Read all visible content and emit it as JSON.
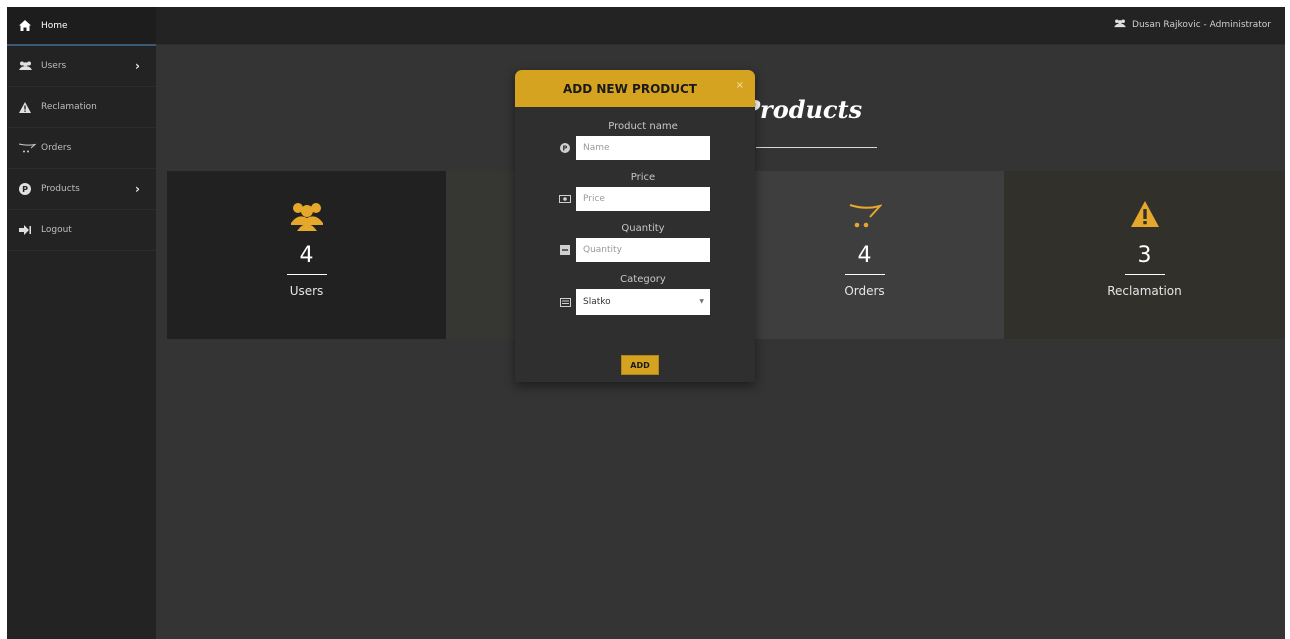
{
  "sidebar": {
    "items": [
      {
        "label": "Home",
        "icon": "home-icon"
      },
      {
        "label": "Users",
        "icon": "users-icon"
      },
      {
        "label": "Reclamation",
        "icon": "warning-icon"
      },
      {
        "label": "Orders",
        "icon": "cart-icon"
      },
      {
        "label": "Products",
        "icon": "product-icon"
      },
      {
        "label": "Logout",
        "icon": "logout-icon"
      }
    ]
  },
  "topbar": {
    "user": "Dusan Rajkovic - Administrator"
  },
  "page": {
    "title": "Products"
  },
  "cards": [
    {
      "value": "4",
      "label": "Users",
      "icon": "users-icon"
    },
    {
      "value": "4",
      "label": "Orders",
      "icon": "cart-icon"
    },
    {
      "value": "3",
      "label": "Reclamation",
      "icon": "warning-icon"
    }
  ],
  "modal": {
    "title": "ADD NEW PRODUCT",
    "close": "×",
    "fields": [
      {
        "label": "Product name",
        "placeholder": "Name"
      },
      {
        "label": "Price",
        "placeholder": "Price"
      },
      {
        "label": "Quantity",
        "placeholder": "Quantity"
      },
      {
        "label": "Category",
        "value": "Slatko"
      }
    ],
    "submit_label": "ADD"
  },
  "colors": {
    "accent": "#d6a321",
    "sidebar": "#232323",
    "background": "#343434"
  }
}
